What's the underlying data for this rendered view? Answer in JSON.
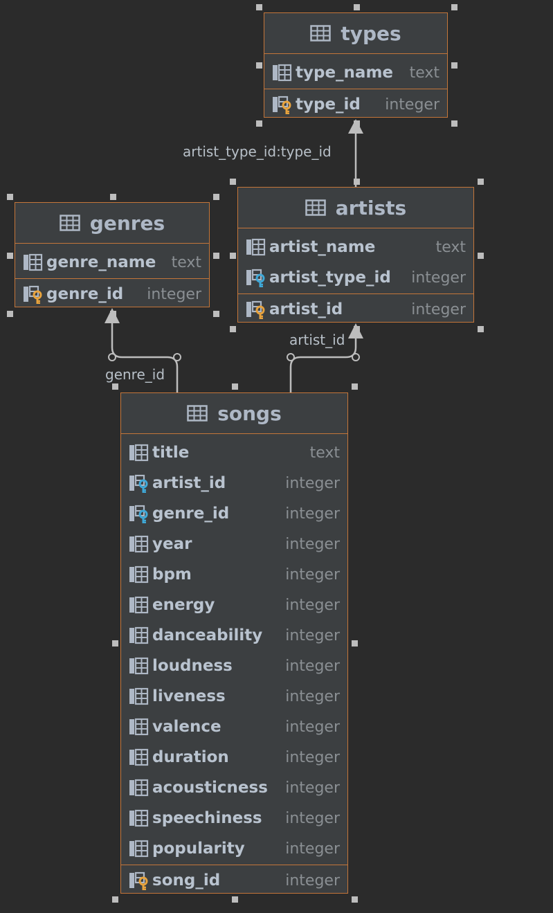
{
  "tables": [
    {
      "id": "types",
      "name": "types",
      "columns": [
        {
          "name": "type_name",
          "type": "text",
          "icon": "column-icon"
        }
      ],
      "pk": {
        "name": "type_id",
        "type": "integer",
        "icon": "primary-key-icon"
      }
    },
    {
      "id": "genres",
      "name": "genres",
      "columns": [
        {
          "name": "genre_name",
          "type": "text",
          "icon": "column-icon"
        }
      ],
      "pk": {
        "name": "genre_id",
        "type": "integer",
        "icon": "primary-key-icon"
      }
    },
    {
      "id": "artists",
      "name": "artists",
      "columns": [
        {
          "name": "artist_name",
          "type": "text",
          "icon": "column-icon"
        },
        {
          "name": "artist_type_id",
          "type": "integer",
          "icon": "foreign-key-icon"
        }
      ],
      "pk": {
        "name": "artist_id",
        "type": "integer",
        "icon": "primary-key-icon"
      }
    },
    {
      "id": "songs",
      "name": "songs",
      "columns": [
        {
          "name": "title",
          "type": "text",
          "icon": "column-icon"
        },
        {
          "name": "artist_id",
          "type": "integer",
          "icon": "foreign-key-icon"
        },
        {
          "name": "genre_id",
          "type": "integer",
          "icon": "foreign-key-icon"
        },
        {
          "name": "year",
          "type": "integer",
          "icon": "column-icon"
        },
        {
          "name": "bpm",
          "type": "integer",
          "icon": "column-icon"
        },
        {
          "name": "energy",
          "type": "integer",
          "icon": "column-icon"
        },
        {
          "name": "danceability",
          "type": "integer",
          "icon": "column-icon"
        },
        {
          "name": "loudness",
          "type": "integer",
          "icon": "column-icon"
        },
        {
          "name": "liveness",
          "type": "integer",
          "icon": "column-icon"
        },
        {
          "name": "valence",
          "type": "integer",
          "icon": "column-icon"
        },
        {
          "name": "duration",
          "type": "integer",
          "icon": "column-icon"
        },
        {
          "name": "acousticness",
          "type": "integer",
          "icon": "column-icon"
        },
        {
          "name": "speechiness",
          "type": "integer",
          "icon": "column-icon"
        },
        {
          "name": "popularity",
          "type": "integer",
          "icon": "column-icon"
        }
      ],
      "pk": {
        "name": "song_id",
        "type": "integer",
        "icon": "primary-key-icon"
      }
    }
  ],
  "relations": [
    {
      "from": "artists",
      "to": "types",
      "label": "artist_type_id:type_id"
    },
    {
      "from": "songs",
      "to": "genres",
      "label": "genre_id"
    },
    {
      "from": "songs",
      "to": "artists",
      "label": "artist_id"
    }
  ],
  "colors": {
    "background": "#2b2b2b",
    "table_fill": "#3c3f41",
    "table_border": "#c5763a",
    "primary_key": "#e8a33d",
    "foreign_key": "#3fa9d8"
  }
}
